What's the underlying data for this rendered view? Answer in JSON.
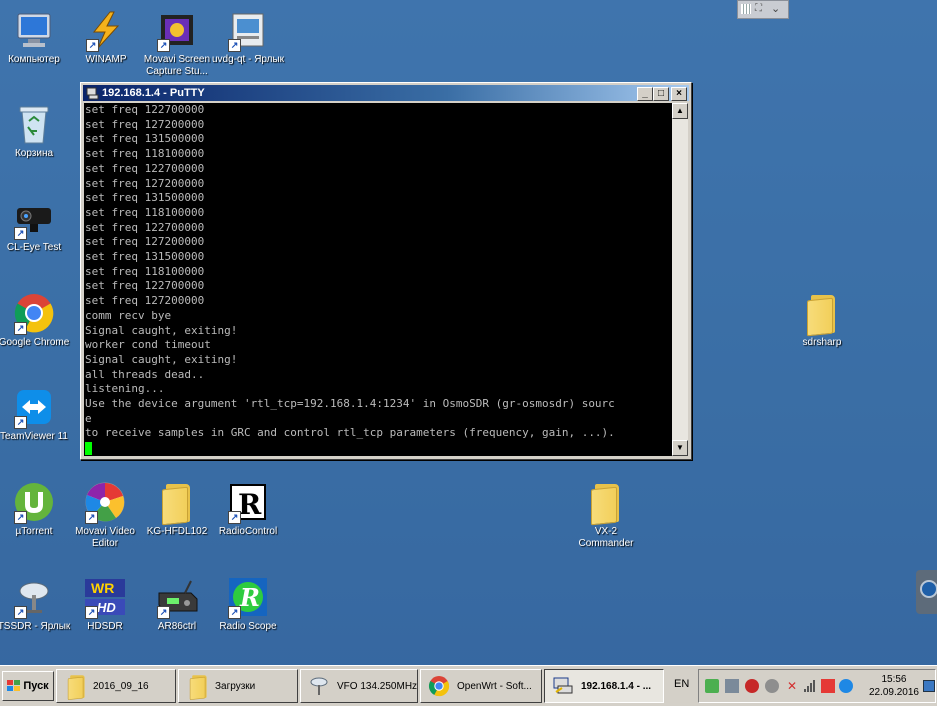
{
  "desktop": {
    "icons": [
      {
        "id": "computer",
        "label": "Компьютер"
      },
      {
        "id": "winamp",
        "label": "WINAMP"
      },
      {
        "id": "movavi-capture",
        "label": "Movavi Screen Capture Stu..."
      },
      {
        "id": "uvdg",
        "label": "uvdg-qt - Ярлык"
      },
      {
        "id": "trash",
        "label": "Корзина"
      },
      {
        "id": "cleye",
        "label": "CL-Eye Test"
      },
      {
        "id": "chrome",
        "label": "Google Chrome"
      },
      {
        "id": "teamviewer",
        "label": "TeamViewer 11"
      },
      {
        "id": "utorrent",
        "label": "µTorrent"
      },
      {
        "id": "movavi-video",
        "label": "Movavi Video Editor"
      },
      {
        "id": "kghfdl",
        "label": "KG-HFDL102"
      },
      {
        "id": "radiocontrol",
        "label": "RadioControl"
      },
      {
        "id": "tssdr",
        "label": "TSSDR - Ярлык"
      },
      {
        "id": "hdsdr",
        "label": "HDSDR"
      },
      {
        "id": "ar86",
        "label": "AR86ctrl"
      },
      {
        "id": "radioscope",
        "label": "Radio Scope"
      },
      {
        "id": "sdrsharp",
        "label": "sdrsharp"
      },
      {
        "id": "vx2",
        "label": "VX-2 Commander"
      }
    ]
  },
  "putty": {
    "title": "192.168.1.4 - PuTTY",
    "lines": [
      "set freq 122700000",
      "set freq 127200000",
      "set freq 131500000",
      "set freq 118100000",
      "set freq 122700000",
      "set freq 127200000",
      "set freq 131500000",
      "set freq 118100000",
      "set freq 122700000",
      "set freq 127200000",
      "set freq 131500000",
      "set freq 118100000",
      "set freq 122700000",
      "set freq 127200000",
      "comm recv bye",
      "Signal caught, exiting!",
      "worker cond timeout",
      "Signal caught, exiting!",
      "all threads dead..",
      "listening...",
      "Use the device argument 'rtl_tcp=192.168.1.4:1234' in OsmoSDR (gr-osmosdr) sourc",
      "e",
      "to receive samples in GRC and control rtl_tcp parameters (frequency, gain, ...)."
    ]
  },
  "taskbar": {
    "start_label": "Пуск",
    "tasks": [
      {
        "label": "2016_09_16"
      },
      {
        "label": "Загрузки"
      },
      {
        "label": "VFO 134.250MHz"
      },
      {
        "label": "OpenWrt - Soft..."
      },
      {
        "label": "192.168.1.4 - ..."
      }
    ],
    "language": "EN",
    "time": "15:56",
    "date": "22.09.2016"
  }
}
